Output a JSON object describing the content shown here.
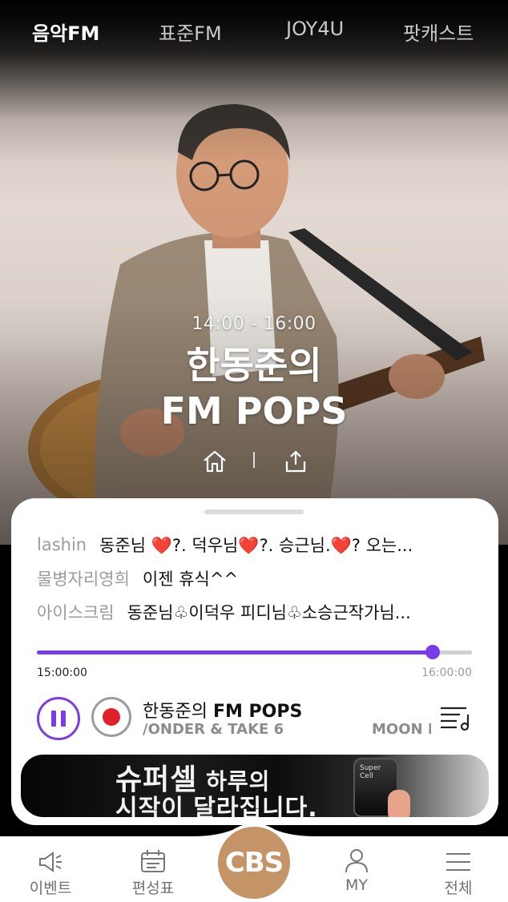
{
  "tabs": [
    {
      "label": "음악FM",
      "active": true
    },
    {
      "label": "표준FM",
      "active": false
    },
    {
      "label": "JOY4U",
      "active": false
    },
    {
      "label": "팟캐스트",
      "active": false
    }
  ],
  "program": {
    "time": "14:00 - 16:00",
    "title_line1": "한동준의",
    "title_line2": "FM POPS",
    "actions": [
      "home-icon",
      "share-icon"
    ]
  },
  "chat": [
    {
      "user": "lashin",
      "message": "동준님 ❤️?.  덕우님❤️?.  승근님.❤️?   오는..."
    },
    {
      "user": "물병자리영희",
      "message": "이젠 휴식^^"
    },
    {
      "user": "아이스크림",
      "message": "동준님♧이덕우 피디님♧소승근작가님..."
    }
  ],
  "player": {
    "start_time": "15:00:00",
    "end_time": "16:00:00",
    "progress": 0.91,
    "now_title_prefix": "한동준의 ",
    "now_title_bold": "FM POPS",
    "now_song_a": "/ONDER & TAKE 6",
    "now_song_b": "MOON RI"
  },
  "banner": {
    "line1_a": "슈퍼셀",
    "line1_b": " 하루의",
    "line2": "시작이 달라집니다.",
    "product_label": "Super Cell"
  },
  "bottom_nav": {
    "events": "이벤트",
    "schedule": "편성표",
    "center": "CBS",
    "my": "MY",
    "all": "전체"
  },
  "colors": {
    "accent": "#7a3ce8",
    "record": "#e0202a",
    "cbs_brand": "#c49466"
  }
}
